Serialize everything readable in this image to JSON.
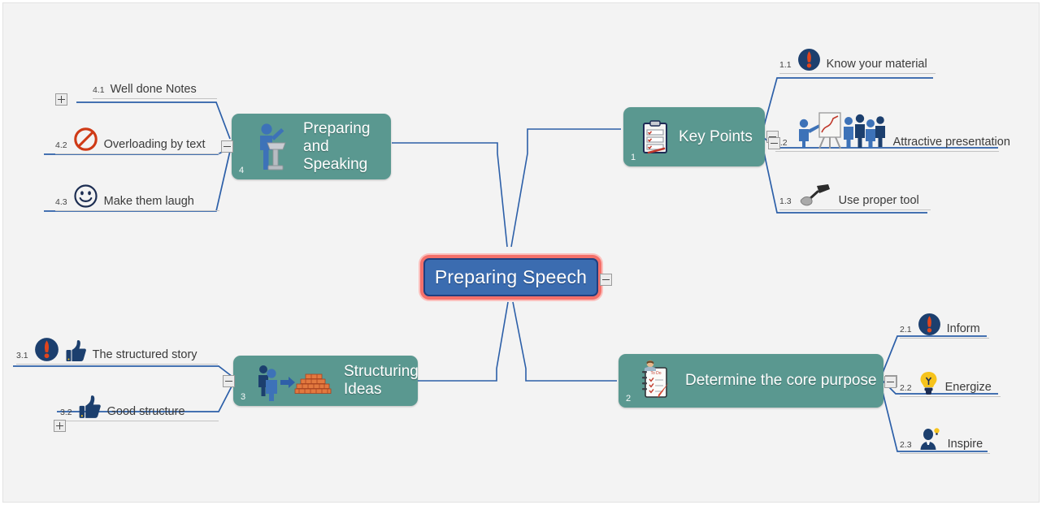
{
  "document": {
    "type": "mind-map",
    "background_color": "#f3f3f3",
    "accent_colors": {
      "central_fill": "#3b6cb0",
      "central_border": "#1f3f80",
      "central_glow": "#f4706a",
      "topic_fill": "#5a9890",
      "connector": "#2c5fa8",
      "leaf_line": "#c4c4c4",
      "leaf_text": "#3a3a3a"
    }
  },
  "central": {
    "label": "Preparing Speech",
    "collapse_button": "minus"
  },
  "topics": [
    {
      "number": "1",
      "label": "Key Points",
      "icon": "clipboard-checklist-icon",
      "collapse_button": "minus",
      "children": [
        {
          "number": "1.1",
          "label": "Know your material",
          "icons": [
            "exclamation-circle-icon"
          ],
          "button": "none"
        },
        {
          "number": "1.2",
          "label": "Attractive presentation",
          "icons": [
            "presenter-flipchart-audience-icon"
          ],
          "button": "minus"
        },
        {
          "number": "1.3",
          "label": "Use proper tool",
          "icons": [
            "hammer-tool-icon"
          ],
          "button": "none"
        }
      ]
    },
    {
      "number": "2",
      "label": "Determine the core purpose",
      "icon": "todo-list-person-icon",
      "collapse_button": "minus",
      "children": [
        {
          "number": "2.1",
          "label": "Inform",
          "icons": [
            "exclamation-circle-icon"
          ],
          "button": "none"
        },
        {
          "number": "2.2",
          "label": "Energize",
          "icons": [
            "lightbulb-icon"
          ],
          "button": "minus"
        },
        {
          "number": "2.3",
          "label": "Inspire",
          "icons": [
            "person-idea-icon"
          ],
          "button": "none"
        }
      ]
    },
    {
      "number": "3",
      "label": "Structuring\nIdeas",
      "icon": "people-arrow-brickwall-icon",
      "collapse_button": "minus",
      "children": [
        {
          "number": "3.1",
          "label": "The structured story",
          "icons": [
            "exclamation-circle-icon",
            "thumbs-up-icon"
          ],
          "button": "none"
        },
        {
          "number": "3.2",
          "label": "Good structure",
          "icons": [
            "thumbs-up-icon"
          ],
          "button": "plus"
        }
      ]
    },
    {
      "number": "4",
      "label": "Preparing\nand Speaking",
      "icon": "speaker-podium-icon",
      "collapse_button": "minus",
      "children": [
        {
          "number": "4.1",
          "label": "Well done Notes",
          "icons": [],
          "button": "plus"
        },
        {
          "number": "4.2",
          "label": "Overloading by text",
          "icons": [
            "prohibition-icon"
          ],
          "button": "none"
        },
        {
          "number": "4.3",
          "label": "Make them laugh",
          "icons": [
            "smiley-face-icon"
          ],
          "button": "none"
        }
      ]
    }
  ]
}
